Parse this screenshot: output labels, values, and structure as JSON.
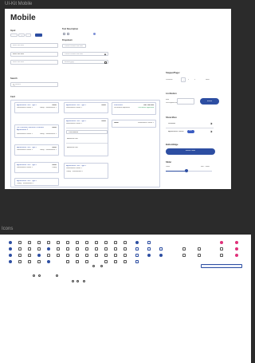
{
  "frames": {
    "mobile_title": "UI-Kit Mobile",
    "icons_title": "Icons"
  },
  "header": {
    "title": "Mobile"
  },
  "colors": {
    "primary": "#2d4ea2",
    "border": "#c9cfe0",
    "badge": "#3a5cc2",
    "heart": "#2d4ea2",
    "pink": "#e0317a"
  },
  "left": {
    "input_label": "Input",
    "stepper_value": "1",
    "field1": "Enter text here",
    "field2": "Enter text here",
    "field3": "Enter text here",
    "search_label": "Search",
    "search_placeholder": "Search",
    "card_label": "Card"
  },
  "mid": {
    "text_desc_label": "Text Description",
    "dropdown_label": "Dropdown",
    "dropdown1": "Please choose one item",
    "dropdown2": "Please choose one item",
    "date_placeholder": "dd.mm.yyyy"
  },
  "cards": [
    {
      "title": "Appointment Title / Type 1",
      "time": "09:41",
      "sub": "Somewhere Street 1",
      "meta": "Today · Somewhere 1"
    },
    {
      "title": "Joe Lastname Someone Lastname Appointment 2",
      "time": "09:41",
      "sub": "Somewhere Street 1",
      "meta": "Today · Somewhere 1"
    },
    {
      "title": "Appointment Title / Type 1",
      "time": "09:41",
      "sub": "Somewhere Street 1",
      "meta": "Today · Somewhere 1"
    },
    {
      "title": "Appointment Title / Type 1",
      "time": "09:41",
      "sub": "Somewhere Street 1",
      "meta": "Today"
    },
    {
      "title": "Appointment Title / Type 1",
      "time": "09:41",
      "sub": "Somewhere Street 1",
      "meta": "Today · Somewhere 1"
    },
    {
      "title": "Appointment Title / Type 1",
      "time": "09:41",
      "sub": "Somewhere Street 1",
      "meta": "Today · Somewhere 1"
    },
    {
      "title": "Appointment Title / Type 1",
      "time": "09:41",
      "sub": "Somewhere Street 1",
      "meta": "Today · Somewhere 1"
    }
  ],
  "status_card": {
    "title": "Information",
    "value": "Ref. 000 000",
    "line1": "Document approved",
    "line2": "Document approved"
  },
  "info_card": {
    "title": "Label",
    "right": "Somewhere Street 1"
  },
  "expanded_card": {
    "field": "Consultation",
    "detail1": "Additional text",
    "detail2": "Additional text"
  },
  "right": {
    "pager_label": "Stepper/Pager",
    "pager_prev": "Previous",
    "pager_next": "Next",
    "pager_pages": [
      "1",
      "2",
      "3"
    ],
    "list_label": "List Button",
    "list_item_title": "Item",
    "list_item_sub": "Description for list item",
    "list_button": "Button",
    "show_more_label": "Show More",
    "show_more_1": "Standard",
    "show_more_2": "Appointment Details",
    "show_more_badge": "New",
    "button_label": "Button/Edge",
    "button_text": "Button Label",
    "slider_label": "Slider",
    "slider_min": "Value",
    "slider_max": "Min · Value",
    "slider_value": 0.45
  },
  "icons": {
    "names": [
      "home-icon",
      "chat-icon",
      "calendar-icon",
      "mail-icon",
      "document-icon",
      "info-icon",
      "heart-icon",
      "user-icon",
      "search-icon",
      "settings-icon",
      "close-icon",
      "check-icon",
      "star-icon",
      "share-icon",
      "plus-icon",
      "minus-icon",
      "arrow-icon",
      "bell-icon",
      "lock-icon",
      "location-icon"
    ]
  }
}
